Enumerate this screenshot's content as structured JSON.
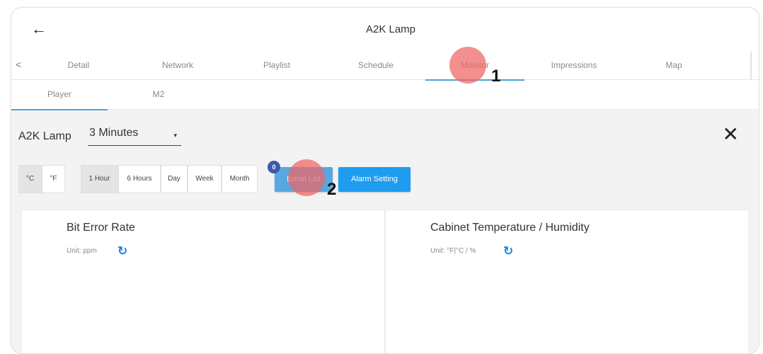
{
  "header": {
    "title": "A2K Lamp",
    "back_icon": "←"
  },
  "tabs": {
    "prev_arrow": "<",
    "items": [
      {
        "label": "Detail"
      },
      {
        "label": "Network"
      },
      {
        "label": "Playlist"
      },
      {
        "label": "Schedule"
      },
      {
        "label": "Monitor",
        "active": true
      },
      {
        "label": "Impressions"
      },
      {
        "label": "Map"
      }
    ]
  },
  "subtabs": [
    {
      "label": "Player",
      "active": true
    },
    {
      "label": "M2"
    }
  ],
  "controls": {
    "device_name": "A2K Lamp",
    "interval_value": "3 Minutes",
    "caret": "▾",
    "close_icon": "✕",
    "units": [
      {
        "label": "°C",
        "active": true
      },
      {
        "label": "°F"
      }
    ],
    "ranges": [
      {
        "label": "1 Hour",
        "active": true
      },
      {
        "label": "6 Hours"
      },
      {
        "label": "Day"
      },
      {
        "label": "Week"
      },
      {
        "label": "Month"
      }
    ],
    "email_list_label": "Email List",
    "email_badge": "0",
    "alarm_setting_label": "Alarm Setting"
  },
  "cards": [
    {
      "title": "Bit Error Rate",
      "unit": "Unit: ppm",
      "refresh_icon": "↻"
    },
    {
      "title": "Cabinet Temperature / Humidity",
      "unit": "Unit:  °F|°C / %",
      "refresh_icon": "↻"
    }
  ],
  "markers": [
    {
      "number": "1"
    },
    {
      "number": "2"
    }
  ],
  "colors": {
    "accent": "#4aa3d8",
    "email_button": "#57a8e0",
    "alarm_button": "#1e9cf0",
    "badge": "#3f5aa8",
    "marker": "#f06464"
  }
}
